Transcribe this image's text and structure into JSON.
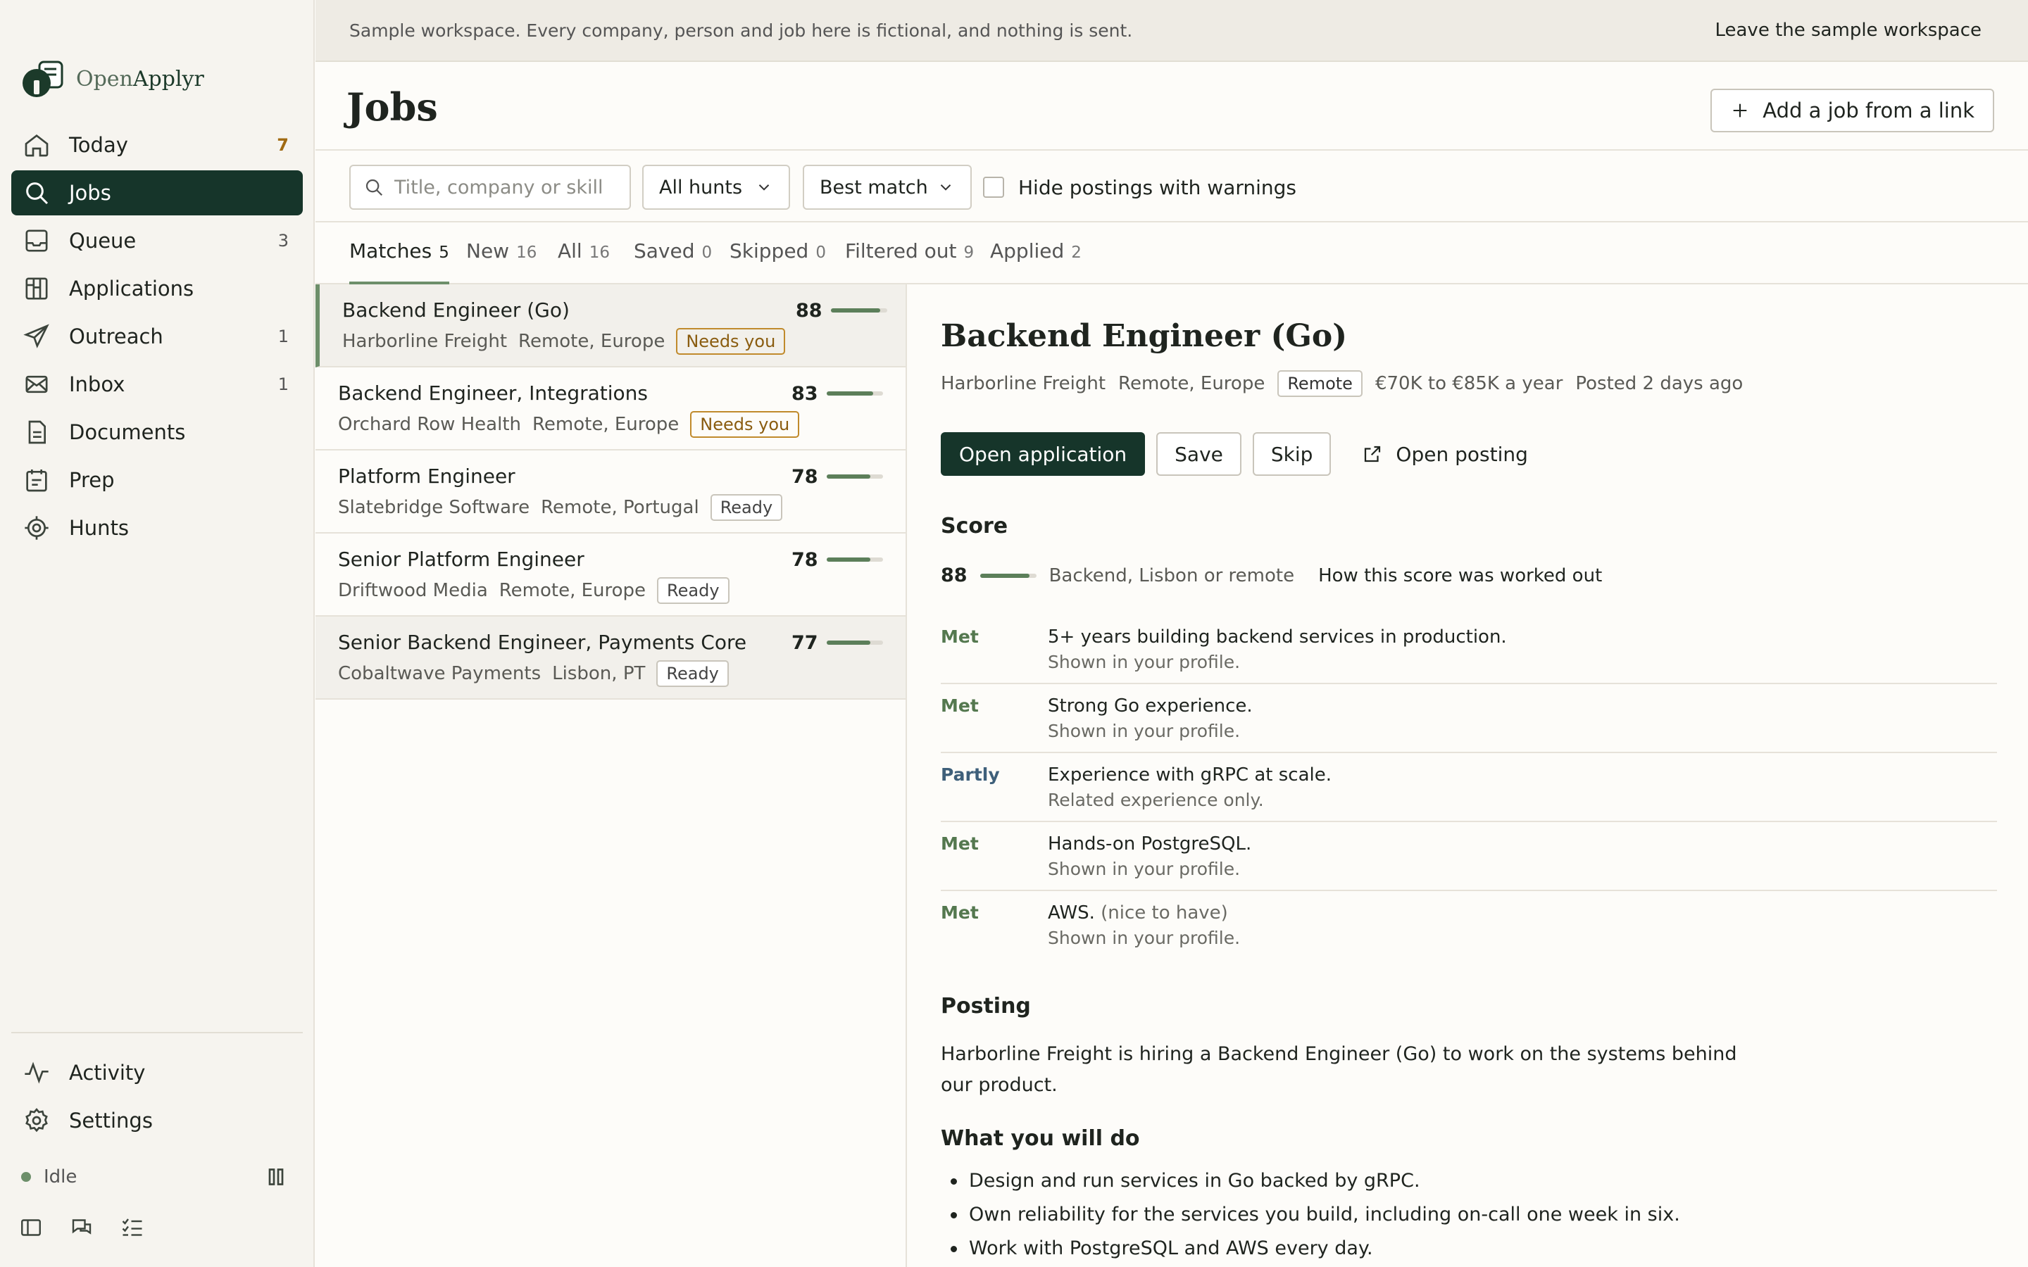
{
  "banner": {
    "text": "Sample workspace. Every company, person and job here is fictional, and nothing is sent.",
    "link": "Leave the sample workspace"
  },
  "app": {
    "name_open": "Open",
    "name_applyr": "Applyr"
  },
  "nav": {
    "items": [
      {
        "label": "Today",
        "count": "7",
        "icon": "home-icon"
      },
      {
        "label": "Jobs",
        "count": "",
        "icon": "search-icon"
      },
      {
        "label": "Queue",
        "count": "3",
        "icon": "inbox-tray-icon"
      },
      {
        "label": "Applications",
        "count": "",
        "icon": "board-icon"
      },
      {
        "label": "Outreach",
        "count": "1",
        "icon": "send-icon"
      },
      {
        "label": "Inbox",
        "count": "1",
        "icon": "mail-icon"
      },
      {
        "label": "Documents",
        "count": "",
        "icon": "document-icon"
      },
      {
        "label": "Prep",
        "count": "",
        "icon": "calendar-icon"
      },
      {
        "label": "Hunts",
        "count": "",
        "icon": "target-icon"
      }
    ],
    "bottom": [
      {
        "label": "Activity",
        "icon": "activity-icon"
      },
      {
        "label": "Settings",
        "icon": "gear-icon"
      }
    ],
    "status": "Idle"
  },
  "header": {
    "title": "Jobs",
    "add_button": "Add a job from a link"
  },
  "filters": {
    "search_placeholder": "Title, company or skill",
    "hunts_select": "All hunts",
    "sort_select": "Best match",
    "hide_warnings_label": "Hide postings with warnings"
  },
  "tabs": [
    {
      "label": "Matches",
      "count": "5"
    },
    {
      "label": "New",
      "count": "16"
    },
    {
      "label": "All",
      "count": "16"
    },
    {
      "label": "Saved",
      "count": "0"
    },
    {
      "label": "Skipped",
      "count": "0"
    },
    {
      "label": "Filtered out",
      "count": "9"
    },
    {
      "label": "Applied",
      "count": "2"
    }
  ],
  "jobs": [
    {
      "title": "Backend Engineer (Go)",
      "company": "Harborline Freight",
      "location": "Remote, Europe",
      "badge": "Needs you",
      "badge_type": "needs",
      "score": "88",
      "score_value": 88
    },
    {
      "title": "Backend Engineer, Integrations",
      "company": "Orchard Row Health",
      "location": "Remote, Europe",
      "badge": "Needs you",
      "badge_type": "needs",
      "score": "83",
      "score_value": 83
    },
    {
      "title": "Platform Engineer",
      "company": "Slatebridge Software",
      "location": "Remote, Portugal",
      "badge": "Ready",
      "badge_type": "ready",
      "score": "78",
      "score_value": 78
    },
    {
      "title": "Senior Platform Engineer",
      "company": "Driftwood Media",
      "location": "Remote, Europe",
      "badge": "Ready",
      "badge_type": "ready",
      "score": "78",
      "score_value": 78
    },
    {
      "title": "Senior Backend Engineer, Payments Core",
      "company": "Cobaltwave Payments",
      "location": "Lisbon, PT",
      "badge": "Ready",
      "badge_type": "ready",
      "score": "77",
      "score_value": 77
    }
  ],
  "detail": {
    "title": "Backend Engineer (Go)",
    "company": "Harborline Freight",
    "location": "Remote, Europe",
    "tag": "Remote",
    "salary": "€70K to €85K a year",
    "posted": "Posted 2 days ago",
    "actions": {
      "open_application": "Open application",
      "save": "Save",
      "skip": "Skip",
      "open_posting": "Open posting"
    },
    "score_heading": "Score",
    "score": "88",
    "score_value": 88,
    "score_focus": "Backend, Lisbon or remote",
    "score_link": "How this score was worked out",
    "requirements": [
      {
        "status": "Met",
        "text": "5+ years building backend services in production.",
        "note": "",
        "sub": "Shown in your profile."
      },
      {
        "status": "Met",
        "text": "Strong Go experience.",
        "note": "",
        "sub": "Shown in your profile."
      },
      {
        "status": "Partly",
        "text": "Experience with gRPC at scale.",
        "note": "",
        "sub": "Related experience only."
      },
      {
        "status": "Met",
        "text": "Hands-on PostgreSQL.",
        "note": "",
        "sub": "Shown in your profile."
      },
      {
        "status": "Met",
        "text": "AWS.",
        "note": "(nice to have)",
        "sub": "Shown in your profile."
      }
    ],
    "posting_heading": "Posting",
    "posting_text": "Harborline Freight is hiring a Backend Engineer (Go) to work on the systems behind our product.",
    "what_heading": "What you will do",
    "bullets": [
      "Design and run services in Go backed by gRPC.",
      "Own reliability for the services you build, including on-call one week in six.",
      "Work with PostgreSQL and AWS every day."
    ]
  },
  "colors": {
    "accent": "#16352a",
    "score": "#5c7f5a",
    "needs_badge": "#c08a2c"
  }
}
